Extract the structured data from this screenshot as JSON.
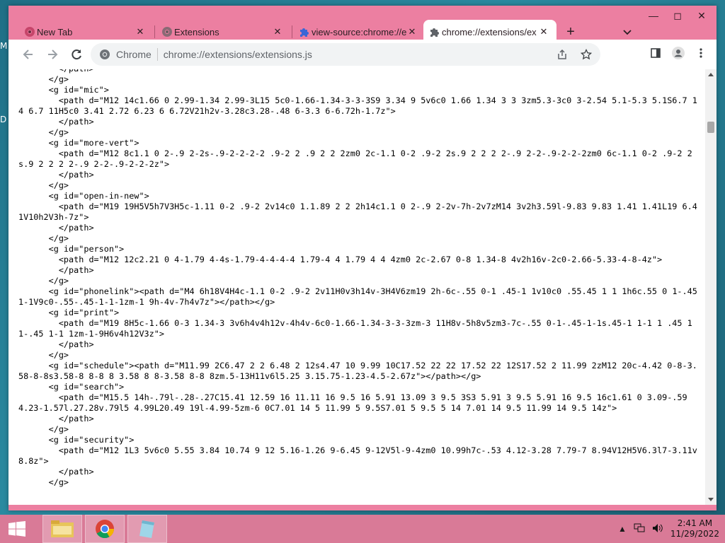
{
  "desktop": {
    "edge_label_1": "M",
    "edge_label_2": "D"
  },
  "tabs": [
    {
      "title": "New Tab",
      "icon": "chrome-icon",
      "active": false
    },
    {
      "title": "Extensions",
      "icon": "chrome-gray-icon",
      "active": false
    },
    {
      "title": "view-source:chrome://e",
      "icon": "puzzle-icon",
      "active": false
    },
    {
      "title": "chrome://extensions/ex",
      "icon": "puzzle-icon",
      "active": true
    }
  ],
  "toolbar": {
    "omnibox_chip": "Chrome",
    "url": "chrome://extensions/extensions.js"
  },
  "source_lines": [
    "        </path>",
    "      </g>",
    "      <g id=\"mic\">",
    "        <path d=\"M12 14c1.66 0 2.99-1.34 2.99-3L15 5c0-1.66-1.34-3-3-3S9 3.34 9 5v6c0 1.66 1.34 3 3 3zm5.3-3c0 3-2.54 5.1-5.3 5.1S6.7 14 6.7 11H5c0 3.41 2.72 6.23 6 6.72V21h2v-3.28c3.28-.48 6-3.3 6-6.72h-1.7z\">",
    "        </path>",
    "      </g>",
    "      <g id=\"more-vert\">",
    "        <path d=\"M12 8c1.1 0 2-.9 2-2s-.9-2-2-2-2 .9-2 2 .9 2 2 2zm0 2c-1.1 0-2 .9-2 2s.9 2 2 2 2-.9 2-2-.9-2-2-2zm0 6c-1.1 0-2 .9-2 2s.9 2 2 2 2-.9 2-2-.9-2-2-2z\">",
    "        </path>",
    "      </g>",
    "      <g id=\"open-in-new\">",
    "        <path d=\"M19 19H5V5h7V3H5c-1.11 0-2 .9-2 2v14c0 1.1.89 2 2 2h14c1.1 0 2-.9 2-2v-7h-2v7zM14 3v2h3.59l-9.83 9.83 1.41 1.41L19 6.41V10h2V3h-7z\">",
    "        </path>",
    "      </g>",
    "      <g id=\"person\">",
    "        <path d=\"M12 12c2.21 0 4-1.79 4-4s-1.79-4-4-4-4 1.79-4 4 1.79 4 4 4zm0 2c-2.67 0-8 1.34-8 4v2h16v-2c0-2.66-5.33-4-8-4z\">",
    "        </path>",
    "      </g>",
    "      <g id=\"phonelink\"><path d=\"M4 6h18V4H4c-1.1 0-2 .9-2 2v11H0v3h14v-3H4V6zm19 2h-6c-.55 0-1 .45-1 1v10c0 .55.45 1 1 1h6c.55 0 1-.45 1-1V9c0-.55-.45-1-1-1zm-1 9h-4v-7h4v7z\"></path></g>",
    "      <g id=\"print\">",
    "        <path d=\"M19 8H5c-1.66 0-3 1.34-3 3v6h4v4h12v-4h4v-6c0-1.66-1.34-3-3-3zm-3 11H8v-5h8v5zm3-7c-.55 0-1-.45-1-1s.45-1 1-1 1 .45 1 1-.45 1-1 1zm-1-9H6v4h12V3z\">",
    "        </path>",
    "      </g>",
    "      <g id=\"schedule\"><path d=\"M11.99 2C6.47 2 2 6.48 2 12s4.47 10 9.99 10C17.52 22 22 17.52 22 12S17.52 2 11.99 2zM12 20c-4.42 0-8-3.58-8-8s3.58-8 8-8 8 3.58 8 8-3.58 8-8 8zm.5-13H11v6l5.25 3.15.75-1.23-4.5-2.67z\"></path></g>",
    "      <g id=\"search\">",
    "        <path d=\"M15.5 14h-.79l-.28-.27C15.41 12.59 16 11.11 16 9.5 16 5.91 13.09 3 9.5 3S3 5.91 3 9.5 5.91 16 9.5 16c1.61 0 3.09-.59 4.23-1.57l.27.28v.79l5 4.99L20.49 19l-4.99-5zm-6 0C7.01 14 5 11.99 5 9.5S7.01 5 9.5 5 14 7.01 14 9.5 11.99 14 9.5 14z\">",
    "        </path>",
    "      </g>",
    "      <g id=\"security\">",
    "        <path d=\"M12 1L3 5v6c0 5.55 3.84 10.74 9 12 5.16-1.26 9-6.45 9-12V5l-9-4zm0 10.99h7c-.53 4.12-3.28 7.79-7 8.94V12H5V6.3l7-3.11v8.8z\">",
    "        </path>",
    "      </g>"
  ],
  "taskbar": {
    "apps": [
      "file-explorer-icon",
      "chrome-icon",
      "notebook-icon"
    ],
    "time": "2:41 AM",
    "date": "11/29/2022"
  }
}
